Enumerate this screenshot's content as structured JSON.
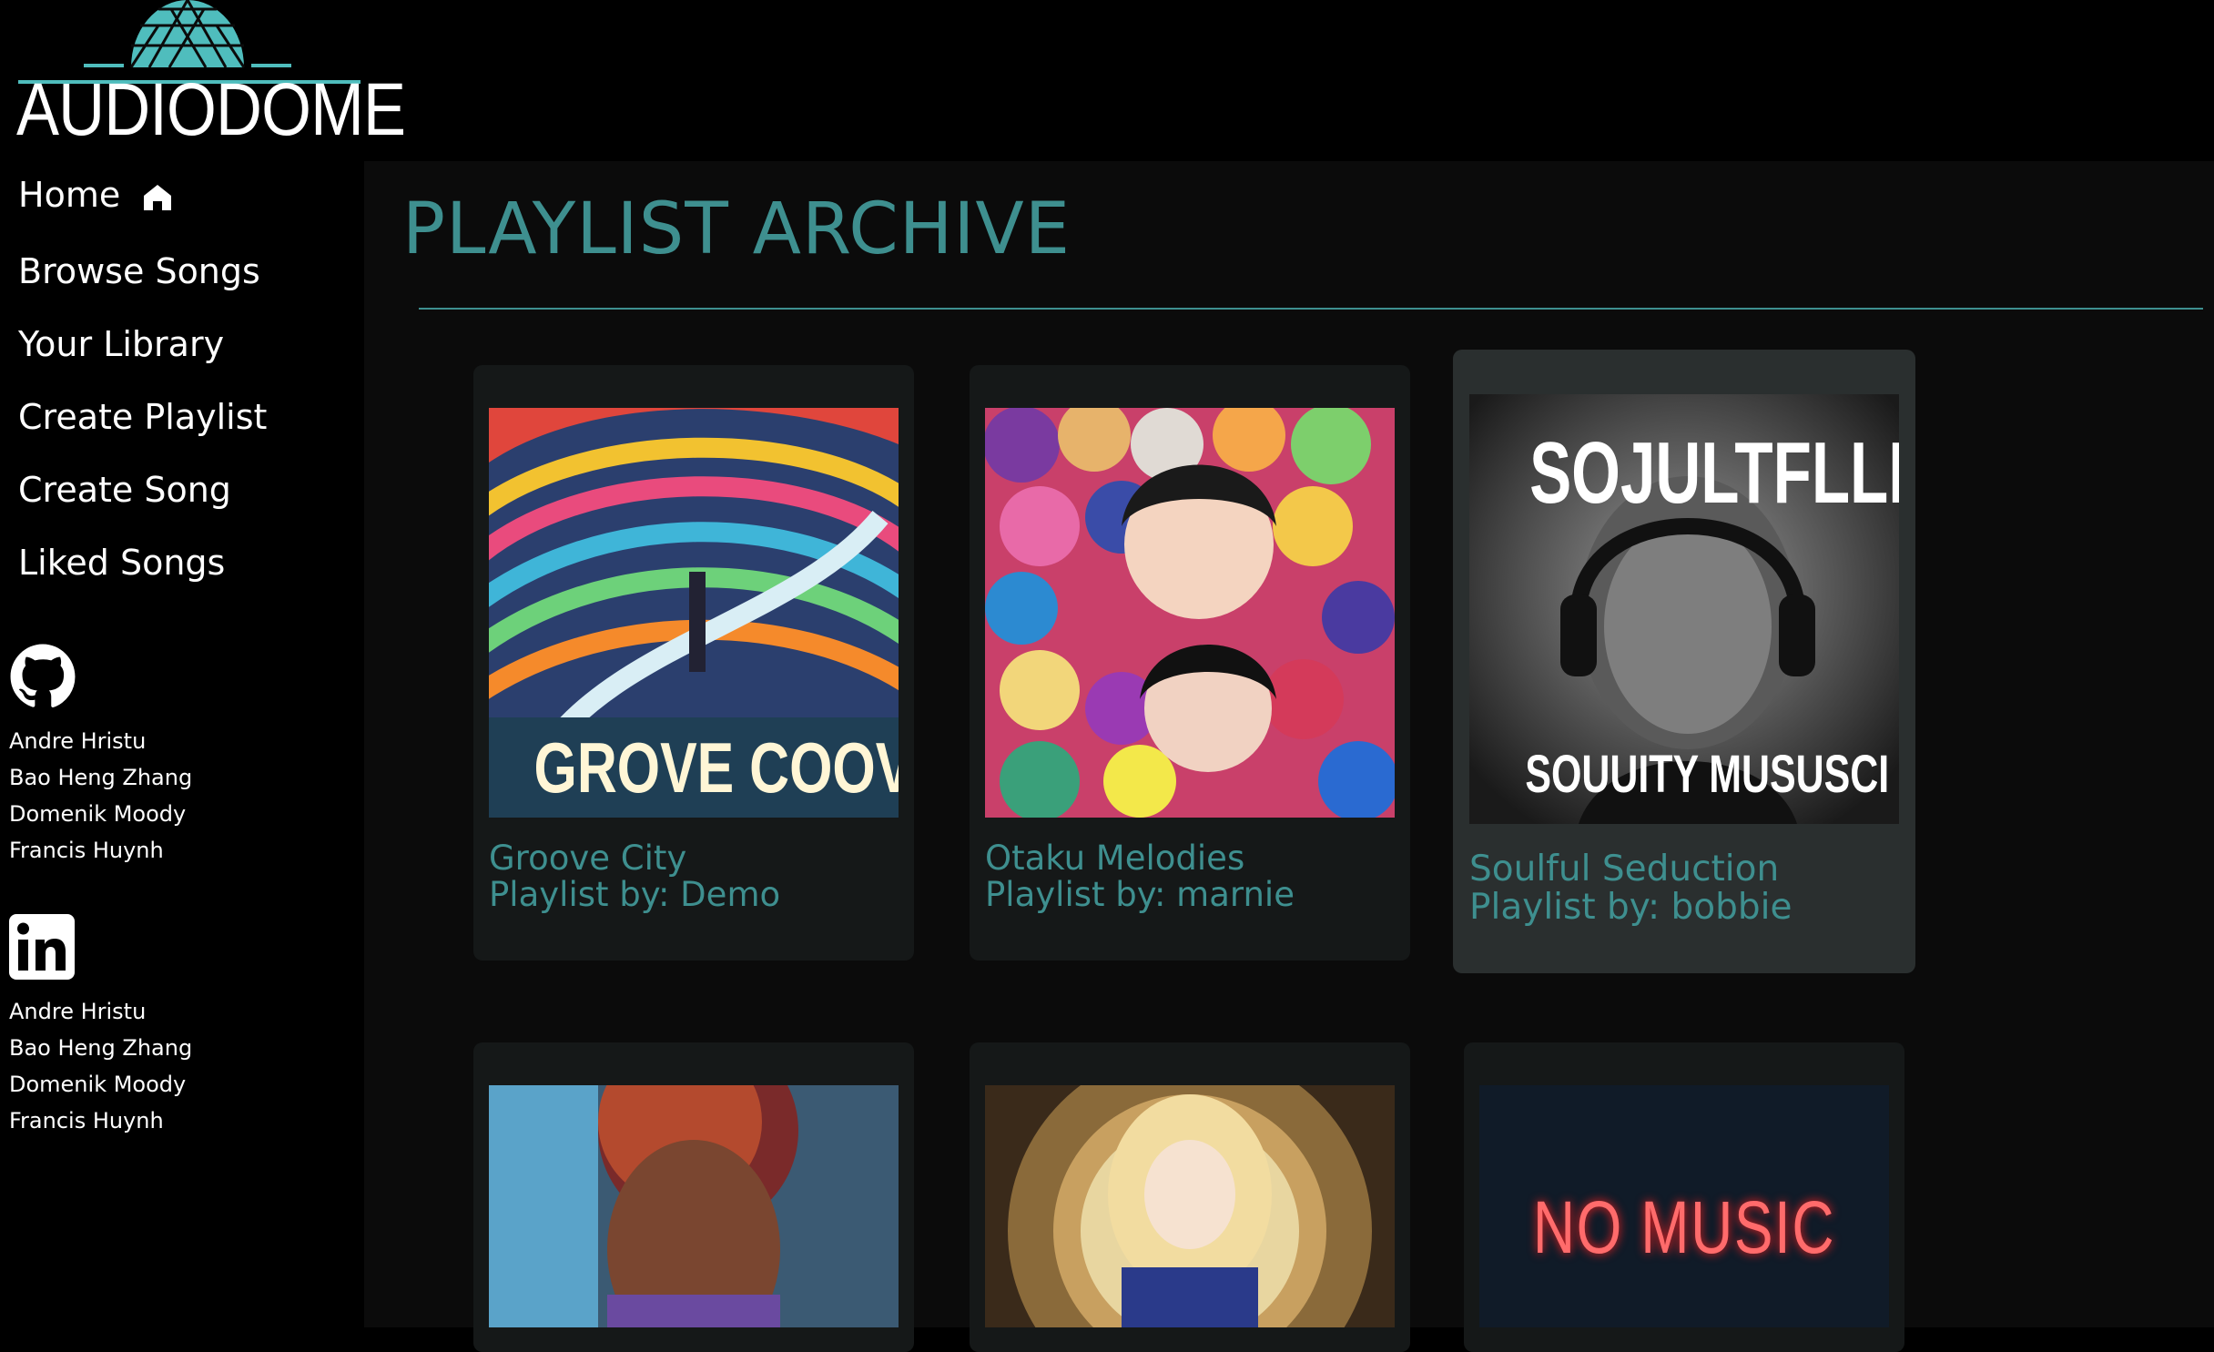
{
  "brand": {
    "name": "AUDIODOME"
  },
  "nav": [
    {
      "label": "Home",
      "icon": "home-icon"
    },
    {
      "label": "Browse Songs"
    },
    {
      "label": "Your Library"
    },
    {
      "label": "Create Playlist"
    },
    {
      "label": "Create Song"
    },
    {
      "label": "Liked Songs"
    }
  ],
  "github": {
    "icon": "github-icon",
    "people": [
      "Andre Hristu",
      "Bao Heng Zhang",
      "Domenik Moody",
      "Francis Huynh"
    ]
  },
  "linkedin": {
    "icon": "linkedin-icon",
    "people": [
      "Andre Hristu",
      "Bao Heng Zhang",
      "Domenik Moody",
      "Francis Huynh"
    ]
  },
  "page": {
    "title": "PLAYLIST ARCHIVE"
  },
  "playlists": [
    {
      "title": "Groove City",
      "owner": "Playlist by: Demo",
      "cover_text": "GROVE COOVITY"
    },
    {
      "title": "Otaku Melodies",
      "owner": "Playlist by: marnie",
      "cover_text": ""
    },
    {
      "title": "Soulful Seduction",
      "owner": "Playlist by: bobbie",
      "cover_text_top": "SOJULTFLLLY",
      "cover_text_bottom": "SOUUITY MUSUSCI"
    },
    {
      "title": "",
      "owner": ""
    },
    {
      "title": "",
      "owner": ""
    },
    {
      "title": "",
      "owner": "",
      "cover_text": "NO MUSIC"
    }
  ],
  "colors": {
    "accent": "#3e8f8f",
    "sidebar_bg": "#000000",
    "main_bg": "#0b0b0b",
    "card_bg": "#151818",
    "card_hover_bg": "#2a2f2f"
  }
}
